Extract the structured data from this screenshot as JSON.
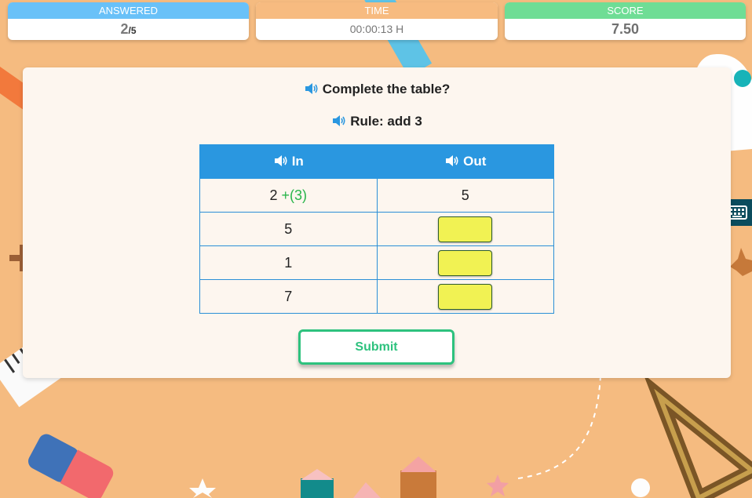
{
  "stats": {
    "answered": {
      "label": "ANSWERED",
      "value": "2",
      "total": "/5"
    },
    "time": {
      "label": "TIME",
      "value": "00:00:13 H"
    },
    "score": {
      "label": "SCORE",
      "value": "7.50"
    }
  },
  "question": {
    "text": "Complete the table?"
  },
  "rule": {
    "text": "Rule: add 3"
  },
  "table": {
    "headers": {
      "in": "In",
      "out": "Out"
    },
    "rows": [
      {
        "in": "2",
        "hint": "+(3)",
        "out": "5",
        "editable": false
      },
      {
        "in": "5",
        "out": "",
        "editable": true
      },
      {
        "in": "1",
        "out": "",
        "editable": true
      },
      {
        "in": "7",
        "out": "",
        "editable": true
      }
    ]
  },
  "submit": {
    "label": "Submit"
  },
  "icons": {
    "speaker": "speaker-icon",
    "keyboard": "keyboard-icon"
  },
  "colors": {
    "answered_header": "#69c1f8",
    "time_header": "#f7bb80",
    "score_header": "#6fdd95",
    "table_header": "#2a97e0",
    "input_fill": "#f1f253",
    "submit_accent": "#2ec27e",
    "background": "#f5bb80"
  }
}
